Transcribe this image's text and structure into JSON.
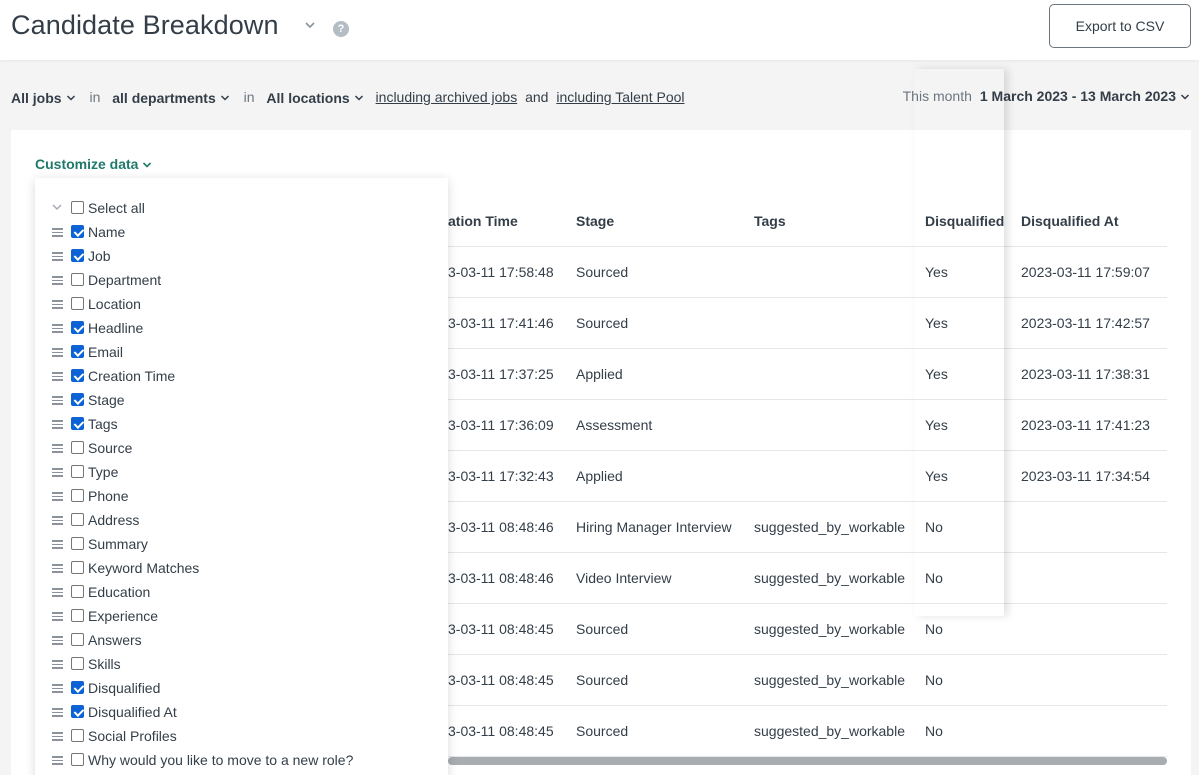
{
  "header": {
    "title": "Candidate Breakdown",
    "help_icon": "?",
    "export_label": "Export to CSV"
  },
  "filters": {
    "jobs": "All jobs",
    "in1": "in",
    "departments": "all departments",
    "in2": "in",
    "locations": "All locations",
    "archived": "including archived jobs",
    "and": "and",
    "talent_pool": "including Talent Pool",
    "period_label": "This month",
    "period_range": "1 March 2023 - 13 March 2023"
  },
  "customize_label": "Customize data",
  "columns": {
    "creation_time": "ation Time",
    "stage": "Stage",
    "tags": "Tags",
    "disqualified": "Disqualified",
    "disqualified_at": "Disqualified At"
  },
  "rows": [
    {
      "time": "3-03-11 17:58:48",
      "stage": "Sourced",
      "tags": "",
      "disq": "Yes",
      "disq_at": "2023-03-11 17:59:07"
    },
    {
      "time": "3-03-11 17:41:46",
      "stage": "Sourced",
      "tags": "",
      "disq": "Yes",
      "disq_at": "2023-03-11 17:42:57"
    },
    {
      "time": "3-03-11 17:37:25",
      "stage": "Applied",
      "tags": "",
      "disq": "Yes",
      "disq_at": "2023-03-11 17:38:31"
    },
    {
      "time": "3-03-11 17:36:09",
      "stage": "Assessment",
      "tags": "",
      "disq": "Yes",
      "disq_at": "2023-03-11 17:41:23"
    },
    {
      "time": "3-03-11 17:32:43",
      "stage": "Applied",
      "tags": "",
      "disq": "Yes",
      "disq_at": "2023-03-11 17:34:54"
    },
    {
      "time": "3-03-11 08:48:46",
      "stage": "Hiring Manager Interview",
      "tags": "suggested_by_workable",
      "disq": "No",
      "disq_at": ""
    },
    {
      "time": "3-03-11 08:48:46",
      "stage": "Video Interview",
      "tags": "suggested_by_workable",
      "disq": "No",
      "disq_at": ""
    },
    {
      "time": "3-03-11 08:48:45",
      "stage": "Sourced",
      "tags": "suggested_by_workable",
      "disq": "No",
      "disq_at": ""
    },
    {
      "time": "3-03-11 08:48:45",
      "stage": "Sourced",
      "tags": "suggested_by_workable",
      "disq": "No",
      "disq_at": ""
    },
    {
      "time": "3-03-11 08:48:45",
      "stage": "Sourced",
      "tags": "suggested_by_workable",
      "disq": "No",
      "disq_at": ""
    }
  ],
  "fields": [
    {
      "label": "Select all",
      "checked": false
    },
    {
      "label": "Name",
      "checked": true
    },
    {
      "label": "Job",
      "checked": true
    },
    {
      "label": "Department",
      "checked": false
    },
    {
      "label": "Location",
      "checked": false
    },
    {
      "label": "Headline",
      "checked": true
    },
    {
      "label": "Email",
      "checked": true
    },
    {
      "label": "Creation Time",
      "checked": true
    },
    {
      "label": "Stage",
      "checked": true
    },
    {
      "label": "Tags",
      "checked": true
    },
    {
      "label": "Source",
      "checked": false
    },
    {
      "label": "Type",
      "checked": false
    },
    {
      "label": "Phone",
      "checked": false
    },
    {
      "label": "Address",
      "checked": false
    },
    {
      "label": "Summary",
      "checked": false
    },
    {
      "label": "Keyword Matches",
      "checked": false
    },
    {
      "label": "Education",
      "checked": false
    },
    {
      "label": "Experience",
      "checked": false
    },
    {
      "label": "Answers",
      "checked": false
    },
    {
      "label": "Skills",
      "checked": false
    },
    {
      "label": "Disqualified",
      "checked": true
    },
    {
      "label": "Disqualified At",
      "checked": true
    },
    {
      "label": "Social Profiles",
      "checked": false
    },
    {
      "label": "Why would you like to move to a new role?",
      "checked": false
    }
  ]
}
